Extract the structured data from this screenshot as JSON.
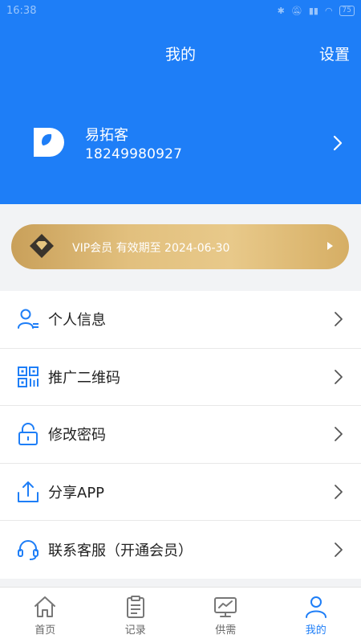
{
  "status_bar": {
    "time": "16:38",
    "battery": "75"
  },
  "header": {
    "title": "我的",
    "settings_label": "设置"
  },
  "profile": {
    "name": "易拓客",
    "phone": "18249980927"
  },
  "vip": {
    "text": "VIP会员 有效期至 2024-06-30"
  },
  "menu": {
    "items": [
      {
        "label": "个人信息",
        "icon": "person-icon"
      },
      {
        "label": "推广二维码",
        "icon": "qr-code-icon"
      },
      {
        "label": "修改密码",
        "icon": "lock-icon"
      },
      {
        "label": "分享APP",
        "icon": "share-icon"
      },
      {
        "label": "联系客服（开通会员）",
        "icon": "headset-icon"
      }
    ]
  },
  "tabbar": {
    "tabs": [
      {
        "label": "首页",
        "icon": "home-icon"
      },
      {
        "label": "记录",
        "icon": "clipboard-icon"
      },
      {
        "label": "供需",
        "icon": "chart-monitor-icon"
      },
      {
        "label": "我的",
        "icon": "user-icon"
      }
    ],
    "active_index": 3
  },
  "colors": {
    "primary": "#1e7ef7",
    "gold": "#dcb56f",
    "background": "#f2f3f5"
  }
}
